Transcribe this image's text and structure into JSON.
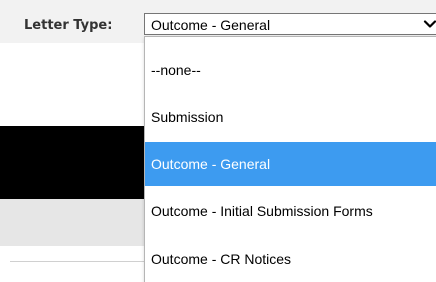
{
  "form": {
    "letter_type_label": "Letter Type:",
    "letter_type_value": "Outcome - General"
  },
  "dropdown": {
    "options": [
      {
        "label": "--none--"
      },
      {
        "label": "Submission"
      },
      {
        "label": "Outcome - General"
      },
      {
        "label": "Outcome - Initial Submission Forms"
      },
      {
        "label": "Outcome - CR Notices"
      }
    ],
    "selected_option": "Outcome - General"
  },
  "colors": {
    "highlight": "#3d9bf0",
    "header_background": "#f2f2f2",
    "band_background": "#e6e6e6"
  },
  "icons": {
    "select_arrow": "chevron-down-icon"
  }
}
